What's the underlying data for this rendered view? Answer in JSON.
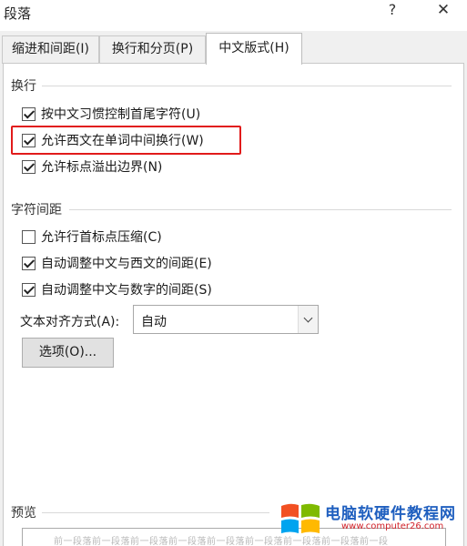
{
  "window": {
    "title": "段落",
    "help_label": "?",
    "close_label": "✕"
  },
  "tabs": [
    {
      "label": "缩进和间距(I)",
      "active": false
    },
    {
      "label": "换行和分页(P)",
      "active": false
    },
    {
      "label": "中文版式(H)",
      "active": true
    }
  ],
  "sections": {
    "line_break": {
      "title": "换行",
      "options": [
        {
          "label": "按中文习惯控制首尾字符(U)",
          "checked": true
        },
        {
          "label": "允许西文在单词中间换行(W)",
          "checked": true,
          "highlighted": true
        },
        {
          "label": "允许标点溢出边界(N)",
          "checked": true
        }
      ]
    },
    "char_spacing": {
      "title": "字符间距",
      "options": [
        {
          "label": "允许行首标点压缩(C)",
          "checked": false
        },
        {
          "label": "自动调整中文与西文的间距(E)",
          "checked": true
        },
        {
          "label": "自动调整中文与数字的间距(S)",
          "checked": true
        }
      ],
      "alignment_label": "文本对齐方式(A):",
      "alignment_value": "自动",
      "options_button": "选项(O)..."
    },
    "preview": {
      "title": "预览",
      "sample_text": "前一段落前一段落前一段落前一段落前一段落前一段落前一段落前一段落前一段"
    }
  },
  "watermark": {
    "title": "电脑软硬件教程网",
    "url": "www.computer26.com",
    "colors": {
      "red": "#f25022",
      "green": "#7fba00",
      "blue": "#00a4ef",
      "yellow": "#ffb900"
    }
  }
}
